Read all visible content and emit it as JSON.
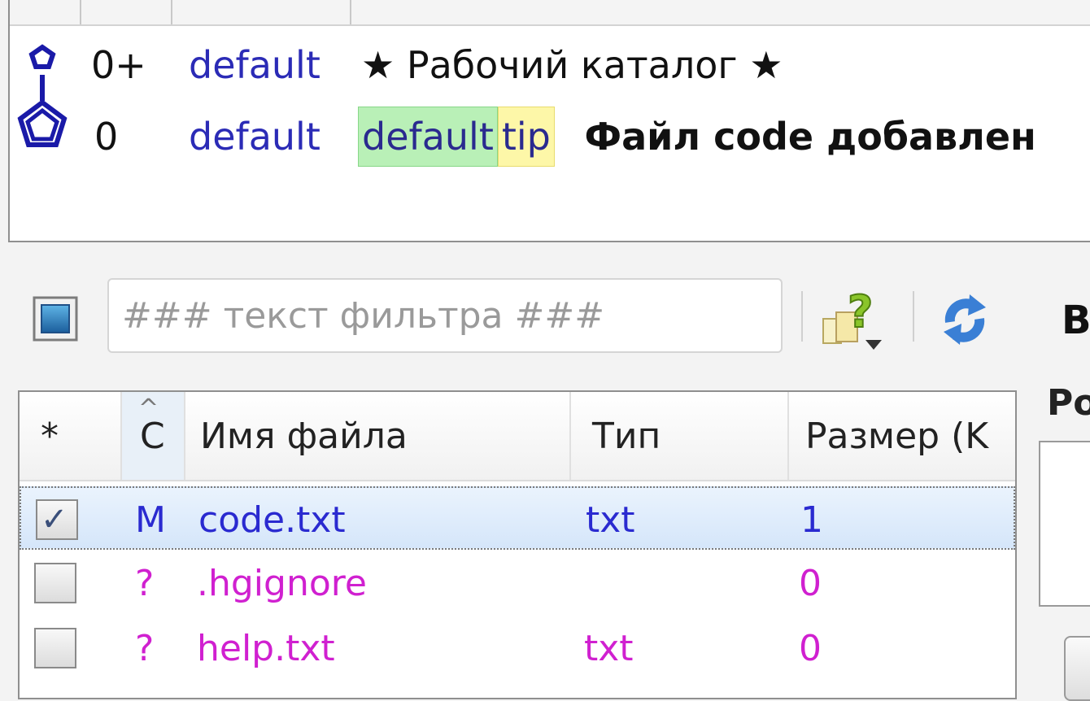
{
  "graph": {
    "rows": [
      {
        "rev": "0+",
        "branch": "default",
        "star_left": "★",
        "desc": "Рабочий каталог",
        "star_right": "★"
      },
      {
        "rev": "0",
        "branch": "default",
        "tag1": "default",
        "tag2": "tip",
        "desc": "Файл code добавлен"
      }
    ]
  },
  "toolbar": {
    "filter_placeholder": "### текст фильтра ###",
    "cut_button_letter": "B"
  },
  "file_list": {
    "columns": {
      "star": "*",
      "status": "C",
      "status_sort_arrow": "^",
      "name": "Имя файла",
      "type": "Тип",
      "size": "Размер (K"
    },
    "rows": [
      {
        "checked": true,
        "check_glyph": "✓",
        "status": "M",
        "name": "code.txt",
        "type": "txt",
        "size": "1"
      },
      {
        "checked": false,
        "check_glyph": "",
        "status": "?",
        "name": ".hgignore",
        "type": "",
        "size": "0"
      },
      {
        "checked": false,
        "check_glyph": "",
        "status": "?",
        "name": "help.txt",
        "type": "txt",
        "size": "0"
      }
    ]
  },
  "right_panel": {
    "label": "Ро"
  },
  "colors": {
    "modified": "#2a2ad0",
    "unknown": "#d020d0",
    "branch": "#2b2bb6",
    "node": "#1a1aa8"
  }
}
